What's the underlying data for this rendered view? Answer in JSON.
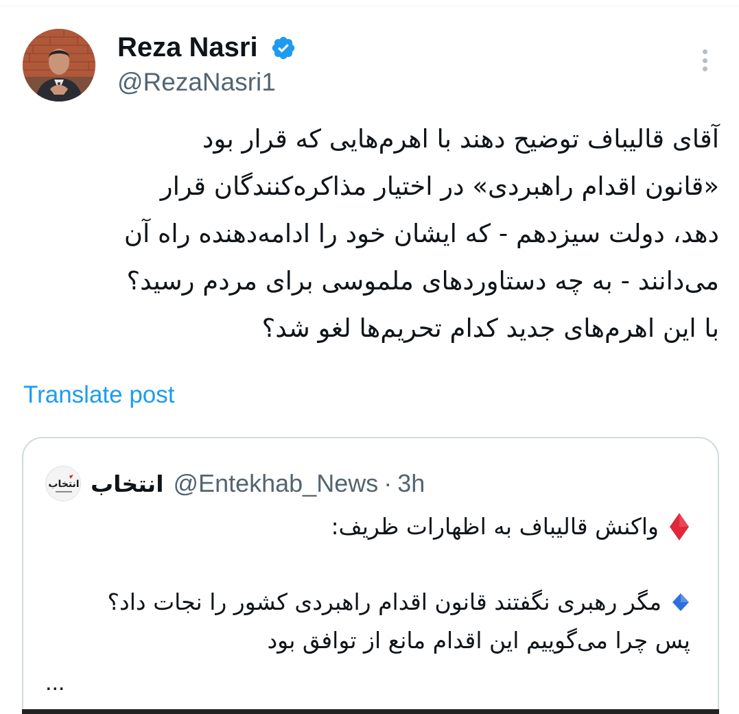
{
  "author": {
    "display_name": "Reza Nasri",
    "handle": "@RezaNasri1",
    "verified": true,
    "verified_badge_color": "#1d9bf0"
  },
  "tweet": {
    "lines": [
      "آقای قالیباف توضیح دهند با اهرم‌هایی که قرار بود",
      "«قانون اقدام راهبردی» در اختیار مذاکره‌کنندگان قرار",
      "دهد، دولت سیزدهم - که ایشان خود را ادامه‌دهنده راه آن",
      "می‌دانند - به چه دستاوردهای ملموسی برای مردم رسید؟",
      "با این اهرم‌های جدید کدام تحریم‌ها لغو شد؟"
    ],
    "translate_label": "Translate post"
  },
  "quote": {
    "name": "انتخاب",
    "handle": "@Entekhab_News",
    "separator": "·",
    "time": "3h",
    "line1": "واکنش قالیباف به اظهارات ظریف:",
    "line2": "مگر رهبری نگفتند قانون اقدام راهبردی کشور را نجات داد؟",
    "line3": "پس چرا می‌گوییم این اقدام مانع از توافق بود",
    "ellipsis": "..."
  },
  "icons": {
    "verified": "verified-badge-icon",
    "more": "more-vertical-icon",
    "bullet1": "red-diamond-icon",
    "bullet2": "blue-diamond-icon"
  },
  "colors": {
    "link": "#1d9bf0",
    "secondary_text": "#536471",
    "border": "#cfd9de"
  }
}
